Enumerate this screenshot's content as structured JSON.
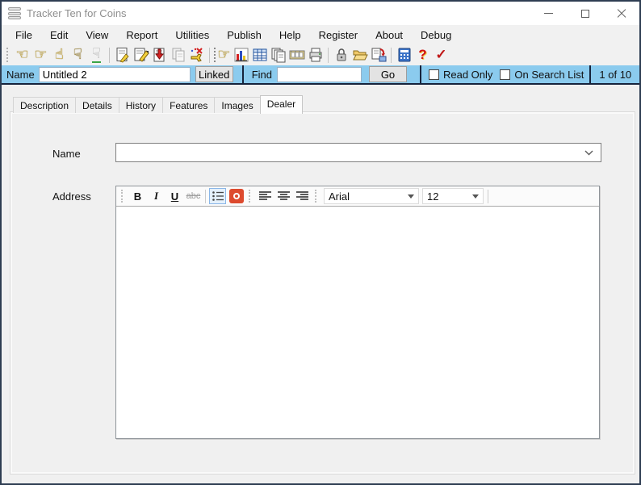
{
  "window": {
    "title": "Tracker Ten for Coins",
    "controls": [
      "minimize",
      "maximize",
      "close"
    ]
  },
  "menubar": {
    "items": [
      "File",
      "Edit",
      "View",
      "Report",
      "Utilities",
      "Publish",
      "Help",
      "Register",
      "About",
      "Debug"
    ]
  },
  "toolbar": {
    "icons": [
      "hand-point-left",
      "hand-point-right",
      "hand-point-up",
      "hand-point-down",
      "hand-outline",
      "record-write",
      "record-edit",
      "record-save-arrow",
      "record-copy-disabled",
      "record-delete",
      "find-record",
      "bar-chart",
      "table-view",
      "copy-pages",
      "film-images",
      "print",
      "lock",
      "open-folder",
      "export-save",
      "calculator",
      "help-question",
      "check-mark"
    ]
  },
  "record_bar": {
    "name_label": "Name",
    "name_value": "Untitled 2",
    "linked_button": "Linked",
    "find_label": "Find",
    "find_value": "",
    "go_button": "Go",
    "read_only_label": "Read Only",
    "on_search_list_label": "On Search List",
    "position_indicator": "1 of 10"
  },
  "tabs": {
    "items": [
      "Description",
      "Details",
      "History",
      "Features",
      "Images",
      "Dealer"
    ],
    "active": "Dealer"
  },
  "form": {
    "name_label": "Name",
    "address_label": "Address"
  },
  "editor": {
    "bold_label": "B",
    "italic_label": "I",
    "underline_label": "U",
    "strikethrough_label": "abc",
    "font_family_value": "Arial",
    "font_size_value": "12",
    "icons": [
      "bullet-list",
      "text-color",
      "align-left",
      "align-center",
      "align-right",
      "font-dropdown",
      "size-dropdown"
    ]
  },
  "colors": {
    "record_bar_background": "#8bcbee",
    "record_bar_border": "#16233c",
    "window_border": "#2e3d52",
    "danger_red": "#d01010"
  }
}
